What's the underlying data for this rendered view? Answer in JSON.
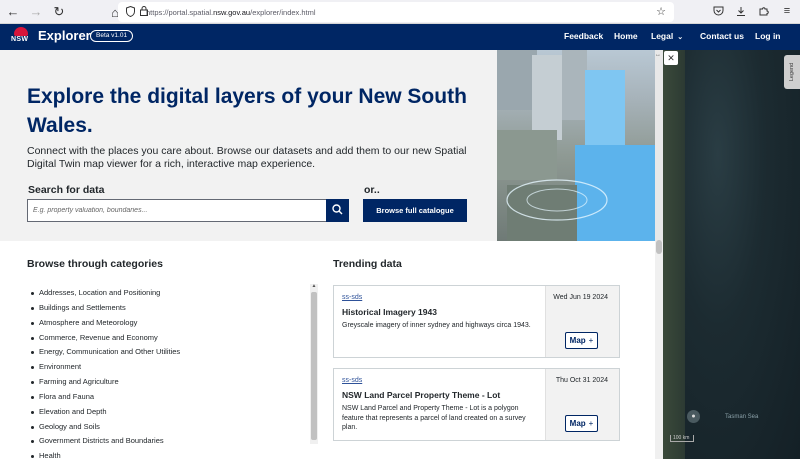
{
  "browser": {
    "url_prefix": "https://portal.spatial.",
    "url_domain": "nsw.gov.au",
    "url_suffix": "/explorer/index.html"
  },
  "header": {
    "logo_text": "NSW",
    "brand": "Explorer",
    "beta_badge": "Beta v1.01",
    "nav": {
      "feedback": "Feedback",
      "home": "Home",
      "legal": "Legal",
      "contact": "Contact us",
      "login": "Log in"
    }
  },
  "hero": {
    "title": "Explore the digital layers of your New South Wales.",
    "description": "Connect with the places you care about. Browse our datasets and add them to our new Spatial Digital Twin map viewer for a rich, interactive map experience.",
    "search_label": "Search for data",
    "search_placeholder": "E.g. property valuation, boundaries...",
    "or_label": "or..",
    "catalogue_button": "Browse full catalogue"
  },
  "categories": {
    "heading": "Browse through categories",
    "items": [
      "Addresses, Location and Positioning",
      "Buildings and Settlements",
      "Atmosphere and Meteorology",
      "Commerce, Revenue and Economy",
      "Energy, Communication and Other Utilities",
      "Environment",
      "Farming and Agriculture",
      "Flora and Fauna",
      "Elevation and Depth",
      "Geology and Soils",
      "Government Districts and Boundaries",
      "Health"
    ]
  },
  "trending": {
    "heading": "Trending data",
    "cards": [
      {
        "tag": "ss-sds",
        "title": "Historical Imagery 1943",
        "description": "Greyscale imagery of inner sydney and highways circa 1943.",
        "date": "Wed Jun 19 2024",
        "button": "Map",
        "button_icon": "+"
      },
      {
        "tag": "ss-sds",
        "title": "NSW Land Parcel Property Theme - Lot",
        "description": "NSW Land Parcel and Property Theme - Lot is a polygon feature that represents a parcel of land created on a survey plan.",
        "date": "Thu Oct 31 2024",
        "button": "Map",
        "button_icon": "+"
      }
    ]
  },
  "map": {
    "legend_tab": "Legend",
    "sea_label": "Tasman Sea",
    "scale_label": "100 km"
  },
  "colors": {
    "nsw_blue": "#002664",
    "nsw_red": "#d7153a",
    "hero_bg": "#f2f2f2"
  }
}
